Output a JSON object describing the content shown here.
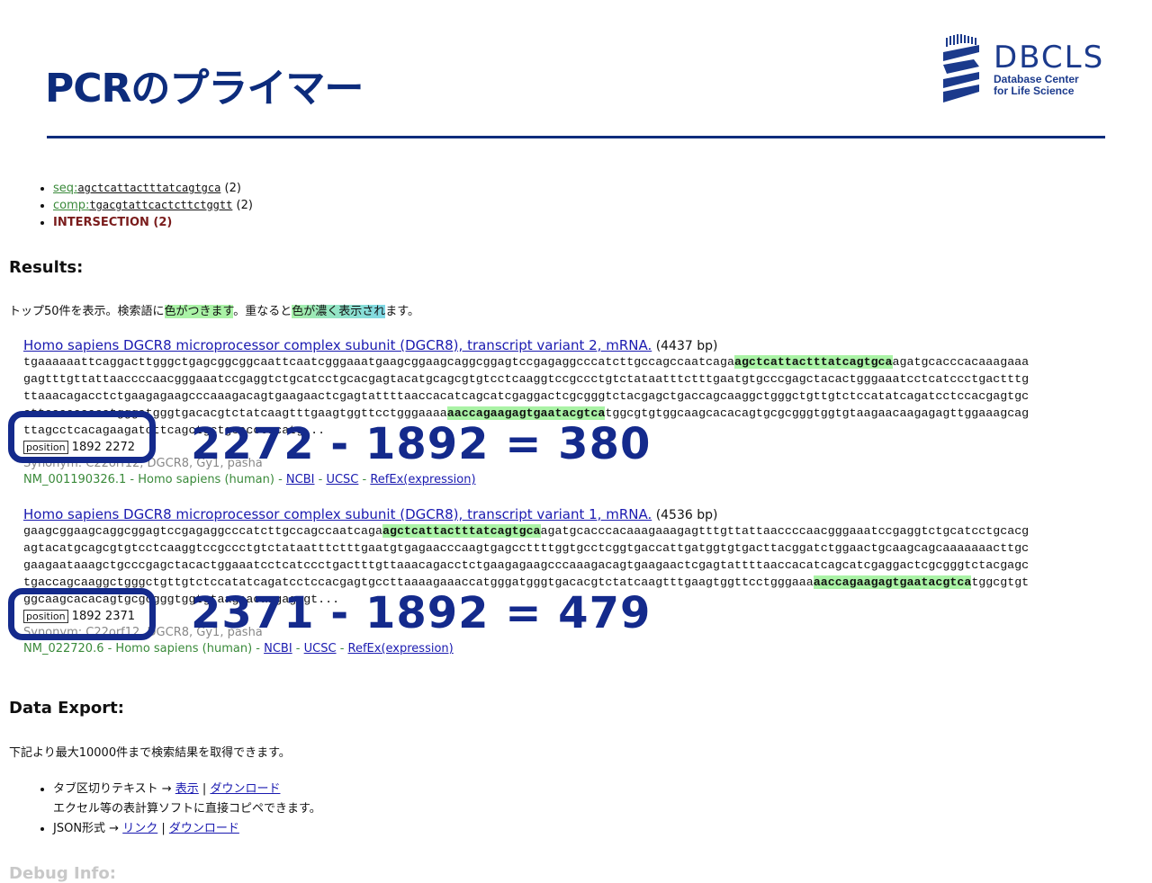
{
  "slide": {
    "title": "PCRのプライマー",
    "logo": {
      "name": "DBCLS",
      "line1": "Database Center",
      "line2": "for Life Science"
    },
    "colors": {
      "title": "#0d2c7c",
      "overlay": "#142a8c",
      "match": "#aaf3a6",
      "link": "#1a1ab0"
    }
  },
  "terms": [
    {
      "label": "seq:",
      "value": "agctcattactttatcagtgca",
      "count": "(2)"
    },
    {
      "label": "comp:",
      "value": "tgacgtattcactcttctggtt",
      "count": "(2)"
    },
    {
      "label": "INTERSECTION (2)"
    }
  ],
  "results": {
    "heading": "Results:",
    "note": {
      "a": "トップ50件を表示。検索語に",
      "b": "色がつきます",
      "c": "。重なると",
      "d": "色が濃く表示され",
      "e": "ます。"
    },
    "hits": [
      {
        "title": "Homo sapiens DGCR8 microprocessor complex subunit (DGCR8), transcript variant 2, mRNA.",
        "bp": "(4437 bp)",
        "seq_pre": "tgaaaaaattcaggacttgggctgagcggcggcaattcaatcgggaaatgaagcggaagcaggcggagtccgagaggcccatcttgccagccaatcaga",
        "match1": "agctcattactttatcagtgca",
        "seq_mid": "agatgcacccacaaagaaagagtttgttattaaccccaacgggaaatccgaggtctgcatcctgcacgagtacatgcagcgtgtcctcaaggtccgccctgtctataatttctttgaatgtgcccgagctacactgggaaatcctcatccctgactttgttaaacagacctctgaagagaagcccaaagacagtgaagaactcgagtattttaaccacatcagcatcgaggactcgcgggtctacgagctgaccagcaaggctgggctgttgtctccatatcagatcctccacgagtgccttaaaaaaacatgggatgggtgacacgtctatcaagtttgaagtggttcctgggaaaa",
        "match2": "aaccagaagagtgaatacgtca",
        "seq_post": "tggcgtgtggcaagcacacagtgcgcgggtggtgtaagaacaagagagttggaaagcagttagcctcacagaagatcttcagctgctgcacccacatg...",
        "position_label": "position",
        "position": "1892 2272",
        "synonym": "Synonym: C22orf12, DGCR8, Gy1, pasha",
        "accession": "NM_001190326.1 - Homo sapiens (human) -",
        "links": [
          "NCBI",
          "UCSC",
          "RefEx(expression)"
        ],
        "calc": "2272 - 1892 = 380"
      },
      {
        "title": "Homo sapiens DGCR8 microprocessor complex subunit (DGCR8), transcript variant 1, mRNA.",
        "bp": "(4536 bp)",
        "seq_pre": "gaagcggaagcaggcggagtccgagaggcccatcttgccagccaatcaga",
        "match1": "agctcattactttatcagtgca",
        "seq_mid": "agatgcacccacaaagaaagagtttgttattaaccccaacgggaaatccgaggtctgcatcctgcacgagtacatgcagcgtgtcctcaaggtccgccctgtctataatttctttgaatgtgagaacccaagtgagccttttggtgcctcggtgaccattgatggtgtgacttacggatctggaactgcaagcagcaaaaaaacttgcgaagaataaagctgcccgagctacactggaaatcctcatccctgactttgttaaacagacctctgaagagaagcccaaagacagtgaagaactcgagtattttaaccacatcagcatcgaggactcgcgggtctacgagctgaccagcaaggctgggctgttgtctccatatcagatcctccacgagtgccttaaaagaaaccatgggatgggtgacacgtctatcaagtttgaagtggttcctgggaaa",
        "match2": "aaccagaagagtgaatacgtca",
        "seq_post": "tggcgtgtggcaagcacacagtgcgcgggtggtgtaagaacaagagagt...",
        "position_label": "position",
        "position": "1892 2371",
        "synonym": "Synonym: C22orf12, DGCR8, Gy1, pasha",
        "accession": "NM_022720.6 - Homo sapiens (human) -",
        "links": [
          "NCBI",
          "UCSC",
          "RefEx(expression)"
        ],
        "calc": "2371 - 1892 = 479"
      }
    ]
  },
  "export": {
    "heading": "Data Export:",
    "note": "下記より最大10000件まで検索結果を取得できます。",
    "items": [
      {
        "prefix": "タブ区切りテキスト → ",
        "link1": "表示",
        "sep": " | ",
        "link2": "ダウンロード",
        "sub": "エクセル等の表計算ソフトに直接コピペできます。"
      },
      {
        "prefix": "JSON形式 → ",
        "link1": "リンク",
        "sep": " | ",
        "link2": "ダウンロード"
      }
    ]
  },
  "debug": {
    "heading": "Debug Info:"
  }
}
